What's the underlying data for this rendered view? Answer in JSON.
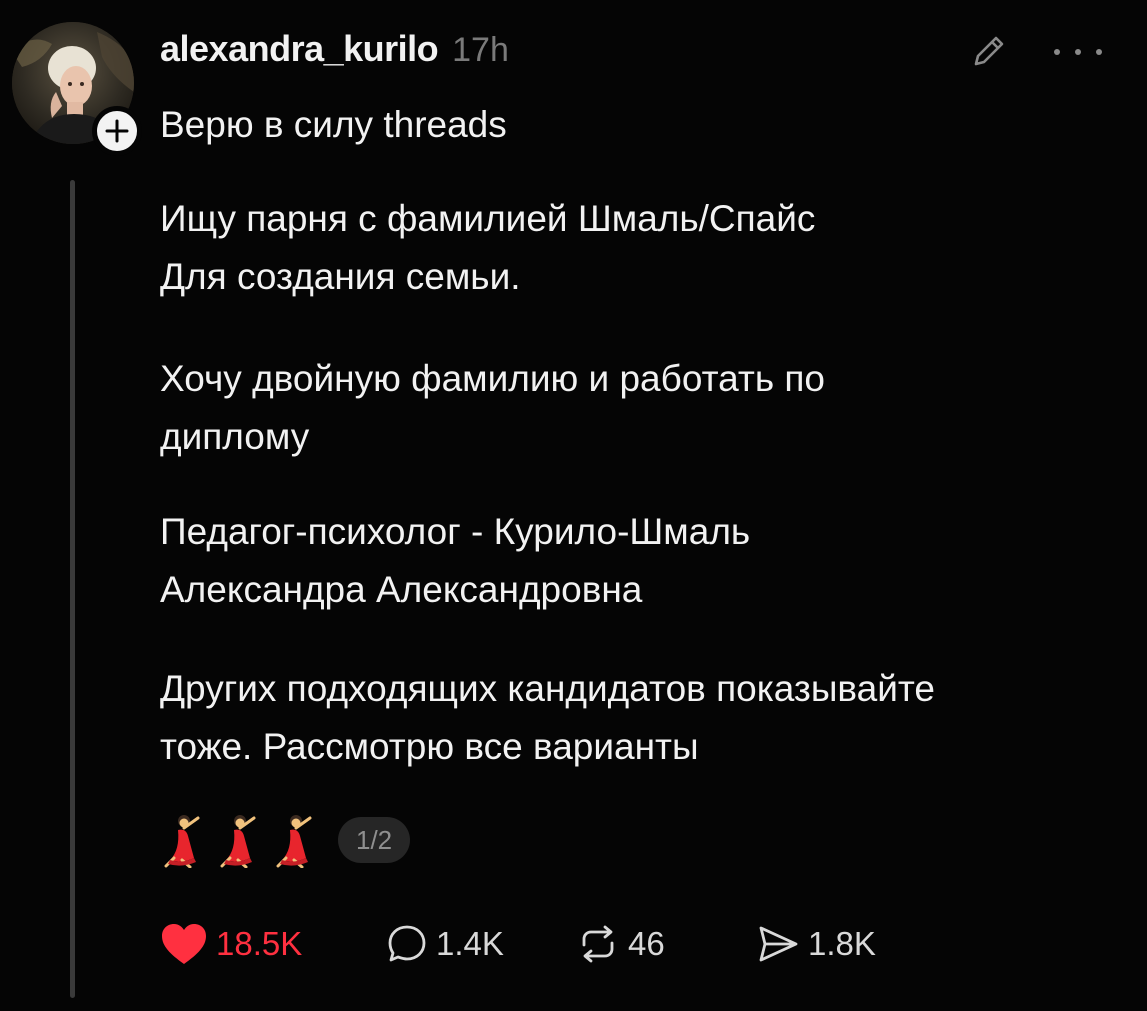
{
  "post": {
    "username": "alexandra_kurilo",
    "time": "17h",
    "topic": "Верю в силу threads",
    "paragraphs": [
      {
        "line1": "Ищу парня с фамилией Шмаль/Спайс",
        "line2": "Для создания семьи."
      },
      {
        "line1": "Хочу двойную фамилию и работать по",
        "line2": "диплому"
      },
      {
        "line1": "Педагог-психолог - Курило-Шмаль",
        "line2": "Александра Александровна"
      },
      {
        "line1": "Других подходящих кандидатов показывайте",
        "line2": "тоже. Рассмотрю все варианты"
      }
    ],
    "media": {
      "thumbnails": [
        "dancer-emoji",
        "dancer-emoji",
        "dancer-emoji"
      ],
      "page_counter": "1/2"
    },
    "stats": {
      "likes": "18.5K",
      "replies": "1.4K",
      "reposts": "46",
      "shares": "1.8K"
    }
  },
  "icons": {
    "edit": "pencil-icon",
    "more": "more-options-icon",
    "follow": "plus-icon",
    "like": "heart-icon",
    "reply": "comment-bubble-icon",
    "repost": "repost-arrows-icon",
    "share": "send-icon"
  },
  "colors": {
    "background": "#050505",
    "text": "#f2f2f2",
    "muted": "#7a7a7a",
    "like": "#ff3040",
    "thread_line": "#3a3a3a"
  }
}
